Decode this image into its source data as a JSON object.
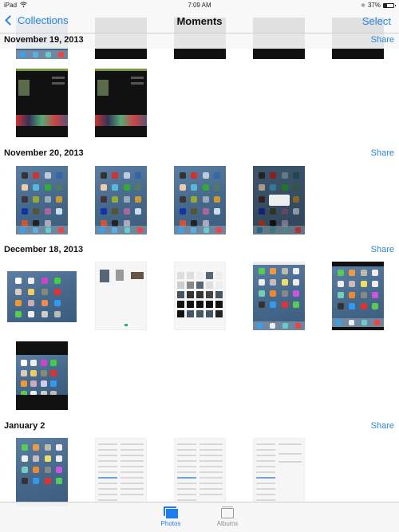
{
  "status_bar": {
    "device": "iPad",
    "time": "7:09 AM",
    "battery_percent": "37%",
    "battery_level": 0.37,
    "wifi_icon": "wifi-icon",
    "bluetooth_icon": "bluetooth-icon"
  },
  "nav": {
    "back_label": "Collections",
    "title": "Moments",
    "select_label": "Select"
  },
  "sections": [
    {
      "date": "November 19, 2013",
      "share_label": "Share",
      "photo_count_visible": 7
    },
    {
      "date": "November 20, 2013",
      "share_label": "Share",
      "photo_count_visible": 4
    },
    {
      "date": "December 18, 2013",
      "share_label": "Share",
      "photo_count_visible": 6
    },
    {
      "date": "January 2",
      "share_label": "Share",
      "photo_count_visible": 4
    }
  ],
  "tab_bar": {
    "tabs": [
      {
        "label": "Photos",
        "icon": "photos-icon",
        "selected": true
      },
      {
        "label": "Albums",
        "icon": "albums-icon",
        "selected": false
      }
    ]
  },
  "colors": {
    "accent": "#2a87d8",
    "tab_selected": "#1b7df0",
    "tab_unselected": "#8e8e93"
  }
}
